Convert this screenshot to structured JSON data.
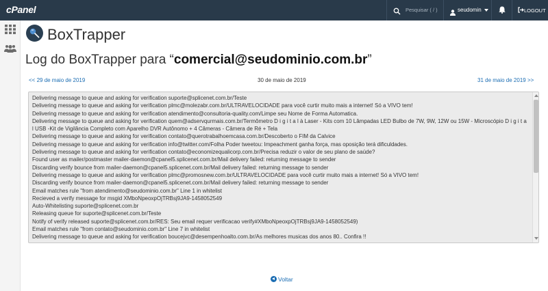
{
  "header": {
    "logo": "cPanel",
    "search_placeholder": "Pesquisar ( / )",
    "username": "seudomin",
    "logout_label": "LOGOUT"
  },
  "icons": {
    "search": "search-icon",
    "user": "user-icon",
    "bell": "bell-icon",
    "logout": "logout-icon",
    "grid": "grid-icon",
    "users": "users-icon",
    "app": "boxtrapper-icon",
    "back": "arrow-left-circle-icon"
  },
  "app": {
    "title": "BoxTrapper"
  },
  "page": {
    "title_prefix": "Log do BoxTrapper para “",
    "email": "comercial@seudominio.com.br",
    "title_suffix": "”"
  },
  "nav": {
    "prev": "<< 29 de maio de 2019",
    "current": "30 de maio de 2019",
    "next": "31 de maio de 2019 >>"
  },
  "log_lines": [
    "Delivering message to queue and asking for verification suporte@splicenet.com.br/Teste",
    "Delivering message to queue and asking for verification plmc@molezabr.com.br/ULTRAVELOCIDADE para você curtir muito mais a internet! Só a VIVO tem!",
    "Delivering message to queue and asking for verification atendimento@consultoria-quality.com/Limpe seu Nome de Forma Automatica.",
    "Delivering message to queue and asking for verification quem@adservqurmais.com.br/Termômetro D i g i t a l à Laser - Kits com 10 Lâmpadas LED Bulbo de 7W, 9W, 12W ou 15W - Microscópio D i g i t a l USB -Kit de Vigilância Completo com Aparelho DVR Autônomo + 4 Câmeras - Câmera de Ré + Tela",
    "Delivering message to queue and asking for verification contato@querotrabalhoemcasa.com.br/Descoberto o FIM da Calvice",
    "Delivering message to queue and asking for verification info@twitter.com/Folha Poder tweetou: Impeachment ganha força, mas oposição terá dificuldades.",
    "Delivering message to queue and asking for verification contato@economizequalicorp.com.br/Precisa reduzir o valor de seu plano de saúde?",
    "Found user as mailer/postmaster mailer-daemon@cpanel5.splicenet.com.br/Mail delivery failed: returning message to sender",
    "Discarding verify bounce from mailer-daemon@cpanel5.splicenet.com.br/Mail delivery failed: returning message to sender",
    "Delivering message to queue and asking for verification plmc@promosnew.com.br/ULTRAVELOCIDADE para você curtir muito mais a internet! Só a VIVO tem!",
    "Discarding verify bounce from mailer-daemon@cpanel5.splicenet.com.br/Mail delivery failed: returning message to sender",
    "Email matches rule \"from atendimento@seudominio.com.br\" Line 1 in whitelist",
    "Recieved a verify message for msgid XMboNpeoxpOjTRBsj9JA9-1458052549",
    "Auto-Whitelisting suporte@splicenet.com.br",
    "Releasing queue for suporte@splicenet.com.br/Teste",
    "Notify of verify released suporte@splicenet.com.br/RES: Seu email requer verificacao verify#XMboNpeoxpOjTRBsj9JA9-1458052549)",
    "Email matches rule \"from contato@seudominio.com.br\" Line 7 in whitelist",
    "Delivering message to queue and asking for verification boucejvc@desempenhoalto.com.br/As melhores musicas dos anos 80.. Confira !!"
  ],
  "footer": {
    "back_label": "Voltar"
  },
  "colors": {
    "topbar": "#293a4a",
    "link": "#1b6db3",
    "log_bg": "#ebebeb"
  }
}
